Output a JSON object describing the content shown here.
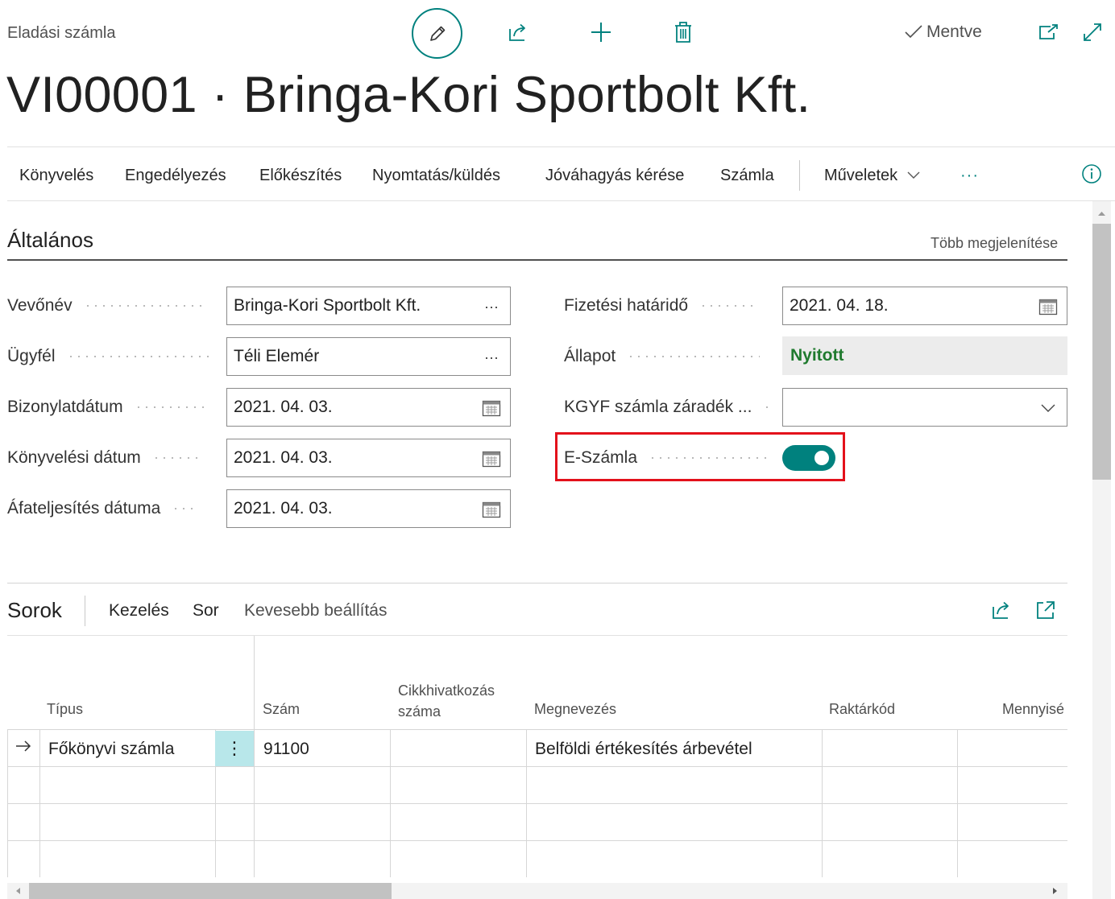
{
  "header": {
    "caption": "Eladási számla",
    "saved_label": "Mentve",
    "title": "VI00001 · Bringa-Kori Sportbolt Kft."
  },
  "actions": [
    "Könyvelés",
    "Engedélyezés",
    "Előkészítés",
    "Nyomtatás/küldés",
    "Jóváhagyás kérése",
    "Számla",
    "Műveletek",
    "···"
  ],
  "general": {
    "section_title": "Általános",
    "show_more": "Több megjelenítése",
    "customer_name_label": "Vevőnév",
    "customer_name_value": "Bringa-Kori Sportbolt Kft.",
    "contact_label": "Ügyfél",
    "contact_value": "Téli Elemér",
    "doc_date_label": "Bizonylatdátum",
    "doc_date_value": "2021. 04. 03.",
    "posting_date_label": "Könyvelési dátum",
    "posting_date_value": "2021. 04. 03.",
    "vat_date_label": "Áfateljesítés dátuma",
    "vat_date_value": "2021. 04. 03.",
    "due_date_label": "Fizetési határidő",
    "due_date_value": "2021. 04. 18.",
    "status_label": "Állapot",
    "status_value": "Nyitott",
    "kgyf_label": "KGYF számla záradék ...",
    "kgyf_value": "",
    "einvoice_label": "E-Számla",
    "einvoice_on": true
  },
  "lines": {
    "title": "Sorok",
    "tabs": [
      "Kezelés",
      "Sor",
      "Kevesebb beállítás"
    ],
    "columns": {
      "type": "Típus",
      "no": "Szám",
      "item_ref_1": "Cikkhivatkozás",
      "item_ref_2": "száma",
      "description": "Megnevezés",
      "location": "Raktárkód",
      "quantity": "Mennyisé"
    },
    "rows": [
      {
        "type": "Főkönyvi számla",
        "no": "91100",
        "item_ref": "",
        "description": "Belföldi értékesítés árbevétel",
        "location": "",
        "quantity": ""
      }
    ]
  },
  "colors": {
    "accent": "#00817e",
    "status_green": "#1f7a2e",
    "highlight_red": "#e3111b",
    "row_menu_bg": "#b8e7ea"
  }
}
